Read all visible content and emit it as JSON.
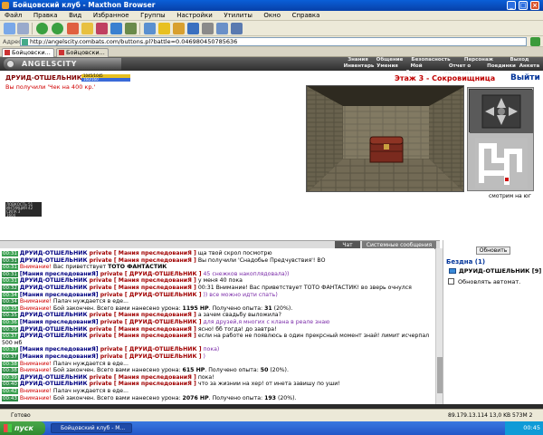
{
  "window": {
    "title": "Бойцовский клуб - Maxthon Browser"
  },
  "menu": [
    "Файл",
    "Правка",
    "Вид",
    "Избранное",
    "Группы",
    "Настройки",
    "Утилиты",
    "Окно",
    "Справка"
  ],
  "address": {
    "label": "Адрес",
    "url": "http://angelscity.combats.com/buttons.pl?battle=0.046980450785636"
  },
  "tabs": [
    {
      "label": "Бойцовски..."
    },
    {
      "label": "Бойцовски..."
    }
  ],
  "game": {
    "logo": "ANGELSCITY",
    "nav_top": [
      "Знания",
      "Общение",
      "Безопасность",
      "Персонаж",
      "Выход"
    ],
    "nav_bottom": [
      "Инвентарь",
      "Умения",
      "Мой Скролл",
      "Отчет о переводах",
      "Поединки",
      "Анкета"
    ],
    "player": {
      "name": "ДРУИД-ОТШЕЛЬНИК [9]",
      "hp_text": "1045/1045",
      "mana_text": "160/160",
      "hp_fraction": 1.0,
      "mana_fraction": 1.0
    },
    "notice": "Вы получили 'Чек на 400 кр.'",
    "location_title": "Этаж 3 - Сокровищница",
    "exit_label": "Выйти",
    "looking": "смотрим на юг",
    "stats_lines": [
      "ЛОВКОСТЬ 51",
      "ИНТУИЦИЯ 42",
      "СИЛА 3",
      "1604"
    ]
  },
  "chat": {
    "tabs": [
      "Чат",
      "Системные сообщения"
    ],
    "lines": [
      {
        "time": "00:31",
        "parts": [
          {
            "t": "ДРУИД-ОТШЕЛЬНИК",
            "c": "nm"
          },
          {
            "t": " private ",
            "c": "pv"
          },
          {
            "t": "[ Мания преследованиЯ ]",
            "c": "pv"
          },
          {
            "t": " ща твой скрол посмотрю",
            "c": ""
          }
        ]
      },
      {
        "time": "00:31",
        "parts": [
          {
            "t": "ДРУИД-ОТШЕЛЬНИК",
            "c": "nm"
          },
          {
            "t": " private ",
            "c": "pv"
          },
          {
            "t": "[ Мания преследованиЯ ]",
            "c": "pv"
          },
          {
            "t": " Вы получили 'Снадобье Предчувствия'! ВО",
            "c": ""
          }
        ]
      },
      {
        "time": "00:31",
        "parts": [
          {
            "t": "Внимание!",
            "c": "sys"
          },
          {
            "t": " Вас приветствует ",
            "c": ""
          },
          {
            "t": "ТОТО ФАНТАСТИК",
            "c": "bold"
          }
        ]
      },
      {
        "time": "00:31",
        "parts": [
          {
            "t": "[Мания преследованиЯ]",
            "c": "nm"
          },
          {
            "t": " private ",
            "c": "pv"
          },
          {
            "t": "[ ДРУИД-ОТШЕЛЬНИК ]",
            "c": "pv"
          },
          {
            "t": " 45 снежков накоплядовала))",
            "c": "vio"
          }
        ]
      },
      {
        "time": "00:31",
        "parts": [
          {
            "t": "ДРУИД-ОТШЕЛЬНИК",
            "c": "nm"
          },
          {
            "t": " private ",
            "c": "pv"
          },
          {
            "t": "[ Мания преследованиЯ ]",
            "c": "pv"
          },
          {
            "t": " у меня 40 пока",
            "c": ""
          }
        ]
      },
      {
        "time": "00:32",
        "parts": [
          {
            "t": "ДРУИД-ОТШЕЛЬНИК",
            "c": "nm"
          },
          {
            "t": " private ",
            "c": "pv"
          },
          {
            "t": "[ Мания преследованиЯ ]",
            "c": "pv"
          },
          {
            "t": " 00:31 Внимание! Вас приветствует ТОТО ФАНТАСТИК! во зверь очнулся",
            "c": ""
          }
        ]
      },
      {
        "time": "00:34",
        "parts": [
          {
            "t": "[Мания преследованиЯ]",
            "c": "nm"
          },
          {
            "t": " private ",
            "c": "pv"
          },
          {
            "t": "[ ДРУИД-ОТШЕЛЬНИК ]",
            "c": "pv"
          },
          {
            "t": " )) все можно идти спать)",
            "c": "vio"
          }
        ]
      },
      {
        "time": "00:34",
        "parts": [
          {
            "t": "Внимание!",
            "c": "sys"
          },
          {
            "t": " Палач нуждается в еде...",
            "c": ""
          }
        ]
      },
      {
        "time": "00:35",
        "parts": [
          {
            "t": "Внимание!",
            "c": "sys"
          },
          {
            "t": " Бой закончен. Всего вами нанесено урона: ",
            "c": ""
          },
          {
            "t": "1195 HP",
            "c": "bold"
          },
          {
            "t": ". Получено опыта: ",
            "c": ""
          },
          {
            "t": "31",
            "c": "bold"
          },
          {
            "t": " (20%).",
            "c": ""
          }
        ]
      },
      {
        "time": "00:35",
        "parts": [
          {
            "t": "ДРУИД-ОТШЕЛЬНИК",
            "c": "nm"
          },
          {
            "t": " private ",
            "c": "pv"
          },
          {
            "t": "[ Мания преследованиЯ ]",
            "c": "pv"
          },
          {
            "t": " а зачем свадьбу выложила?",
            "c": ""
          }
        ]
      },
      {
        "time": "00:36",
        "parts": [
          {
            "t": "[Мания преследованиЯ]",
            "c": "nm"
          },
          {
            "t": " private ",
            "c": "pv"
          },
          {
            "t": "[ ДРУИД-ОТШЕЛЬНИК ]",
            "c": "pv"
          },
          {
            "t": " для друзей,я многих с клана в реале знаю",
            "c": "vio"
          }
        ]
      },
      {
        "time": "00:36",
        "parts": [
          {
            "t": "ДРУИД-ОТШЕЛЬНИК",
            "c": "nm"
          },
          {
            "t": " private ",
            "c": "pv"
          },
          {
            "t": "[ Мания преследованиЯ ]",
            "c": "pv"
          },
          {
            "t": " ясно! бб тогда! до завтра!",
            "c": ""
          }
        ]
      },
      {
        "time": "00:37",
        "parts": [
          {
            "t": "ДРУИД-ОТШЕЛЬНИК",
            "c": "nm"
          },
          {
            "t": " private ",
            "c": "pv"
          },
          {
            "t": "[ Мания преследованиЯ ]",
            "c": "pv"
          },
          {
            "t": " если на работе не появлюсь в один прекрсный момент знай! лимит исчерпал",
            "c": ""
          }
        ]
      },
      {
        "time": "",
        "parts": [
          {
            "t": "500 мб",
            "c": ""
          }
        ]
      },
      {
        "time": "00:37",
        "parts": [
          {
            "t": "[Мания преследованиЯ]",
            "c": "nm"
          },
          {
            "t": " private ",
            "c": "pv"
          },
          {
            "t": "[ ДРУИД-ОТШЕЛЬНИК ]",
            "c": "pv"
          },
          {
            "t": " пока)",
            "c": "vio"
          }
        ]
      },
      {
        "time": "00:37",
        "parts": [
          {
            "t": "[Мания преследованиЯ]",
            "c": "nm"
          },
          {
            "t": " private ",
            "c": "pv"
          },
          {
            "t": "[ ДРУИД-ОТШЕЛЬНИК ]",
            "c": "pv"
          },
          {
            "t": " )",
            "c": "vio"
          }
        ]
      },
      {
        "time": "00:38",
        "parts": [
          {
            "t": "Внимание!",
            "c": "sys"
          },
          {
            "t": " Палач нуждается в еде...",
            "c": ""
          }
        ]
      },
      {
        "time": "00:38",
        "parts": [
          {
            "t": "Внимание!",
            "c": "sys"
          },
          {
            "t": " Бой закончен. Всего вами нанесено урона: ",
            "c": ""
          },
          {
            "t": "615 HP",
            "c": "bold"
          },
          {
            "t": ". Получено опыта: ",
            "c": ""
          },
          {
            "t": "50",
            "c": "bold"
          },
          {
            "t": " (20%).",
            "c": ""
          }
        ]
      },
      {
        "time": "00:39",
        "parts": [
          {
            "t": "ДРУИД-ОТШЕЛЬНИК",
            "c": "nm"
          },
          {
            "t": " private ",
            "c": "pv"
          },
          {
            "t": "[ Мания преследованиЯ ]",
            "c": "pv"
          },
          {
            "t": " пока!",
            "c": ""
          }
        ]
      },
      {
        "time": "00:40",
        "parts": [
          {
            "t": "ДРУИД-ОТШЕЛЬНИК",
            "c": "nm"
          },
          {
            "t": " private ",
            "c": "pv"
          },
          {
            "t": "[ Мания преследованиЯ ]",
            "c": "pv"
          },
          {
            "t": " что за жизнии на хер! от инета завишу по уши!",
            "c": ""
          }
        ]
      },
      {
        "time": "00:42",
        "parts": [
          {
            "t": "Внимание!",
            "c": "sys"
          },
          {
            "t": " Палач нуждается в еде...",
            "c": ""
          }
        ]
      },
      {
        "time": "00:43",
        "parts": [
          {
            "t": "Внимание!",
            "c": "sys"
          },
          {
            "t": " Бой закончен. Всего вами нанесено урона: ",
            "c": ""
          },
          {
            "t": "2076 HP",
            "c": "bold"
          },
          {
            "t": ". Получено опыта: ",
            "c": ""
          },
          {
            "t": "193",
            "c": "bold"
          },
          {
            "t": " (20%).",
            "c": ""
          }
        ]
      }
    ]
  },
  "right_panel": {
    "refresh_label": "Обновить",
    "location_name": "Бездна (1)",
    "player_entry": "ДРУИД-ОТШЕЛЬНИК [9]",
    "auto_update_label": "Обновлять автомат."
  },
  "status": {
    "text": "Готово",
    "right": "89.179.13.114    13,0 KB    573M    2"
  },
  "taskbar": {
    "start_label": "пуск",
    "task_label": "Бойцовский клуб - M...",
    "clock": "00:45"
  }
}
